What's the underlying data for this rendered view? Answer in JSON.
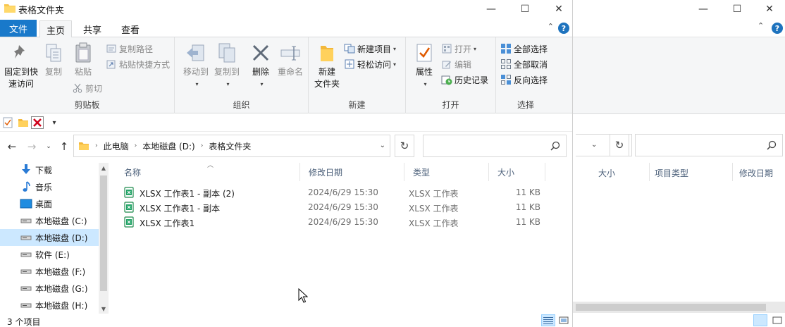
{
  "window": {
    "title": "表格文件夹",
    "controls": {
      "minimize": "—",
      "maximize": "☐",
      "close": "✕"
    }
  },
  "tabs": {
    "file": "文件",
    "home": "主页",
    "share": "共享",
    "view": "查看",
    "help": "?"
  },
  "ribbon": {
    "clipboard": {
      "label": "剪贴板",
      "pin_line1": "固定到快",
      "pin_line2": "速访问",
      "copy": "复制",
      "paste": "粘贴",
      "copy_path": "复制路径",
      "paste_shortcut": "粘贴快捷方式",
      "cut": "剪切"
    },
    "organize": {
      "label": "组织",
      "move_to": "移动到",
      "copy_to": "复制到",
      "delete": "删除",
      "rename": "重命名"
    },
    "new": {
      "label": "新建",
      "new_folder_line1": "新建",
      "new_folder_line2": "文件夹",
      "new_item": "新建项目",
      "easy_access": "轻松访问"
    },
    "open": {
      "label": "打开",
      "properties": "属性",
      "open": "打开",
      "edit": "编辑",
      "history": "历史记录"
    },
    "select": {
      "label": "选择",
      "select_all": "全部选择",
      "select_none": "全部取消",
      "invert": "反向选择"
    }
  },
  "address": {
    "crumbs": [
      "此电脑",
      "本地磁盘 (D:)",
      "表格文件夹"
    ]
  },
  "sidebar": {
    "items": [
      {
        "label": "下载",
        "icon": "download-icon"
      },
      {
        "label": "音乐",
        "icon": "music-icon"
      },
      {
        "label": "桌面",
        "icon": "desktop-icon"
      },
      {
        "label": "本地磁盘 (C:)",
        "icon": "drive-icon"
      },
      {
        "label": "本地磁盘 (D:)",
        "icon": "drive-icon",
        "selected": true
      },
      {
        "label": "软件 (E:)",
        "icon": "drive-icon"
      },
      {
        "label": "本地磁盘 (F:)",
        "icon": "drive-icon"
      },
      {
        "label": "本地磁盘 (G:)",
        "icon": "drive-icon"
      },
      {
        "label": "本地磁盘 (H:)",
        "icon": "drive-icon"
      }
    ]
  },
  "filelist": {
    "columns": {
      "name": "名称",
      "date": "修改日期",
      "type": "类型",
      "size": "大小"
    },
    "rows": [
      {
        "name": "XLSX 工作表1 - 副本 (2)",
        "date": "2024/6/29 15:30",
        "type": "XLSX 工作表",
        "size": "11 KB"
      },
      {
        "name": "XLSX 工作表1 - 副本",
        "date": "2024/6/29 15:30",
        "type": "XLSX 工作表",
        "size": "11 KB"
      },
      {
        "name": "XLSX 工作表1",
        "date": "2024/6/29 15:30",
        "type": "XLSX 工作表",
        "size": "11 KB"
      }
    ]
  },
  "status": {
    "count": "3 个项目"
  },
  "background_window": {
    "columns": {
      "size": "大小",
      "item_type": "项目类型",
      "date": "修改日期"
    }
  },
  "colors": {
    "accent": "#1979ca",
    "selection": "#cce8ff",
    "ribbon_bg": "#f5f6f7",
    "header_text": "#4c607a"
  }
}
